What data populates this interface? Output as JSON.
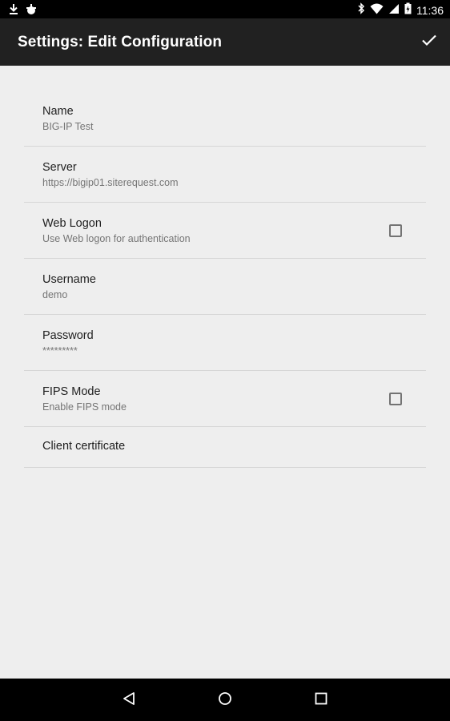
{
  "status_bar": {
    "time": "11:36",
    "left_icons": [
      "download-icon",
      "android-debug-icon"
    ],
    "right_icons": [
      "bluetooth-icon",
      "wifi-icon",
      "signal-icon",
      "battery-charging-icon"
    ]
  },
  "app_bar": {
    "title": "Settings: Edit Configuration",
    "action_icon": "checkmark-icon"
  },
  "preferences": [
    {
      "title": "Name",
      "summary": "BIG-IP Test"
    },
    {
      "title": "Server",
      "summary": "https://bigip01.siterequest.com"
    },
    {
      "title": "Web Logon",
      "summary": "Use Web logon for authentication",
      "checked": false
    },
    {
      "title": "Username",
      "summary": "demo"
    },
    {
      "title": "Password",
      "summary": "*********"
    },
    {
      "title": "FIPS Mode",
      "summary": "Enable FIPS mode",
      "checked": false
    },
    {
      "title": "Client certificate"
    }
  ],
  "nav_bar": {
    "buttons": [
      "back-icon",
      "home-icon",
      "recents-icon"
    ]
  },
  "colors": {
    "app_bar": "#212121",
    "background": "#eeeeee",
    "divider": "#d6d6d6",
    "title_text": "#212121",
    "summary_text": "#757575"
  }
}
